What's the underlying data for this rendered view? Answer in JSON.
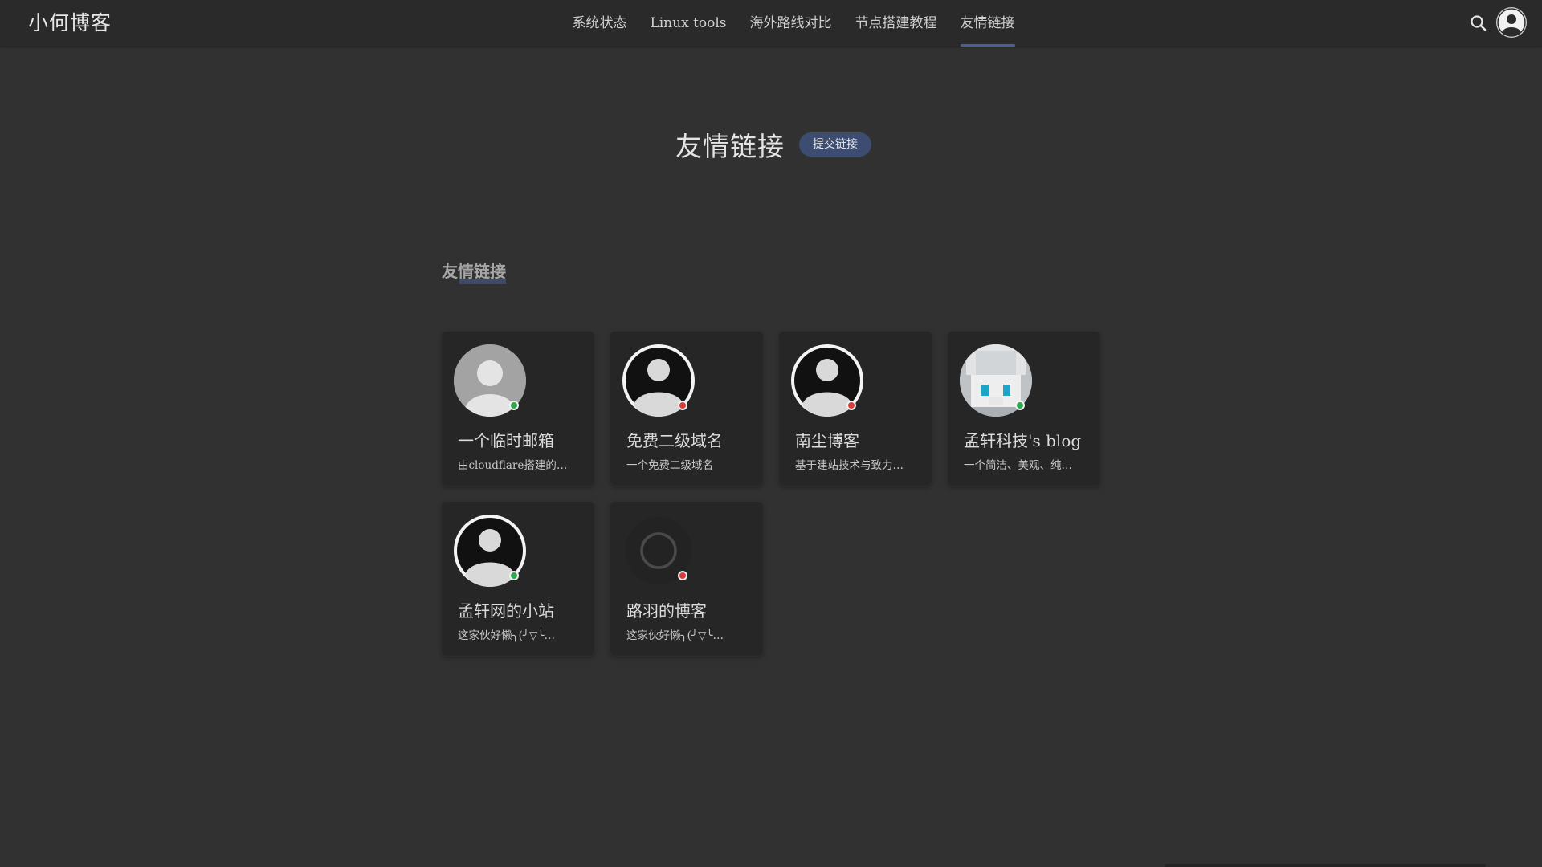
{
  "brand": "小何博客",
  "nav": [
    {
      "label": "系统状态",
      "active": false
    },
    {
      "label": "Linux tools",
      "active": false
    },
    {
      "label": "海外路线对比",
      "active": false
    },
    {
      "label": "节点搭建教程",
      "active": false
    },
    {
      "label": "友情链接",
      "active": true
    }
  ],
  "page": {
    "title": "友情链接",
    "submit_label": "提交链接",
    "section_title": "友情链接"
  },
  "colors": {
    "accent": "#4a5f93",
    "online": "#2fa84f",
    "offline": "#dc3b3b"
  },
  "friends": [
    {
      "name": "一个临时邮箱",
      "desc": "由cloudflare搭建的…",
      "status": "online",
      "avatar": "gray-user-icon"
    },
    {
      "name": "免费二级域名",
      "desc": "一个免费二级域名",
      "status": "offline",
      "avatar": "dark-user-icon"
    },
    {
      "name": "南尘博客",
      "desc": "基于建站技术与致力…",
      "status": "offline",
      "avatar": "dark-user-icon"
    },
    {
      "name": "孟轩科技's blog",
      "desc": "一个简洁、美观、纯…",
      "status": "online",
      "avatar": "anime-avatar"
    },
    {
      "name": "孟轩网的小站",
      "desc": "这家伙好懒╮(╯▽╰…",
      "status": "online",
      "avatar": "dark-user-icon"
    },
    {
      "name": "路羽的博客",
      "desc": "这家伙好懒╮(╯▽╰…",
      "status": "offline",
      "avatar": "loading-spinner-icon"
    }
  ]
}
